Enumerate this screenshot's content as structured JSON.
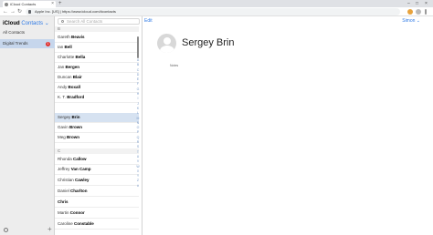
{
  "browser": {
    "tab_title": "iCloud Contacts",
    "tab_close": "×",
    "new_tab": "+",
    "window_controls": [
      "–",
      "□",
      "×"
    ],
    "nav": {
      "back": "←",
      "forward": "→",
      "reload": "↻"
    },
    "address": "Apple Inc. [US] | https://www.icloud.com/#contacts"
  },
  "sidebar": {
    "brand": "iCloud",
    "app": "Contacts",
    "chevron": "⌄",
    "groups": [
      {
        "label": "All Contacts",
        "selected": false
      },
      {
        "label": "Digital Trends",
        "selected": true,
        "badge": "1"
      }
    ],
    "add": "+"
  },
  "list": {
    "search_placeholder": "Search All Contacts",
    "sections": [
      {
        "letter": "B",
        "contacts": [
          {
            "first": "Gareth",
            "last": "Beavis"
          },
          {
            "first": "Ian",
            "last": "Bell"
          },
          {
            "first": "Charlotte",
            "last": "Bella"
          },
          {
            "first": "Jan",
            "last": "Bergen"
          },
          {
            "first": "Duncan",
            "last": "Blair"
          },
          {
            "first": "Andy",
            "last": "Boxall"
          },
          {
            "first": "K. T.",
            "last": "Bradford"
          },
          {
            "first": "Sergey",
            "last": "Brin",
            "selected": true
          },
          {
            "first": "Gavin",
            "last": "Brown"
          },
          {
            "first": "Meg",
            "last": "Brown"
          }
        ]
      },
      {
        "letter": "C",
        "contacts": [
          {
            "first": "Rhonda",
            "last": "Callow"
          },
          {
            "first": "Jeffrey",
            "last": "Van Camp"
          },
          {
            "first": "Christian",
            "last": "Cawley"
          },
          {
            "first": "Daniel",
            "last": "Charlton"
          },
          {
            "first": "",
            "last": "Chris"
          },
          {
            "first": "Martin",
            "last": "Connor"
          },
          {
            "first": "Caroline",
            "last": "Constable"
          }
        ]
      }
    ],
    "index_letters": [
      "A",
      "B",
      "C",
      "D",
      "E",
      "F",
      "G",
      "H",
      "I",
      "J",
      "K",
      "L",
      "M",
      "N",
      "O",
      "P",
      "Q",
      "R",
      "S",
      "T",
      "U",
      "V",
      "W",
      "X",
      "Y",
      "Z",
      "#"
    ]
  },
  "detail": {
    "edit_label": "Edit",
    "user_menu": "Simon ⌄",
    "contact_name": "Sergey Brin",
    "notes_label": "Notes"
  },
  "colors": {
    "accent": "#2f7ae5",
    "selection": "#d6e2f1",
    "badge": "#e0302d"
  }
}
